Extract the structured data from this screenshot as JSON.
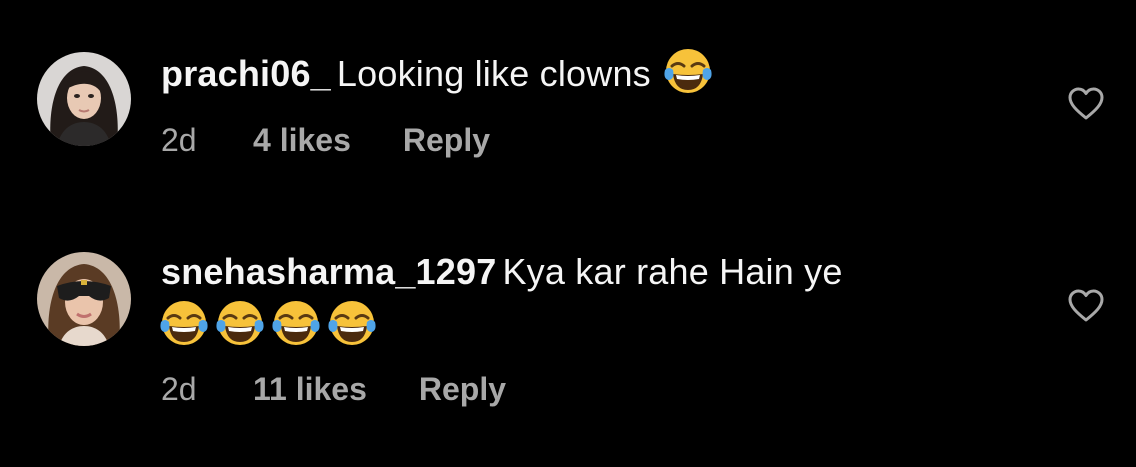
{
  "comments": [
    {
      "username": "prachi06_",
      "text": "Looking like clowns",
      "emoji": [
        "face-with-tears-of-joy"
      ],
      "time": "2d",
      "likes": "4 likes",
      "reply_label": "Reply"
    },
    {
      "username": "snehasharma_1297",
      "text": "Kya kar rahe Hain ye",
      "emoji": [
        "face-with-tears-of-joy",
        "face-with-tears-of-joy",
        "face-with-tears-of-joy",
        "face-with-tears-of-joy"
      ],
      "time": "2d",
      "likes": "11 likes",
      "reply_label": "Reply"
    }
  ],
  "colors": {
    "background": "#000000",
    "text": "#f5f5f5",
    "meta": "#a8a8a8",
    "heart_outline": "#a8a8a8"
  }
}
